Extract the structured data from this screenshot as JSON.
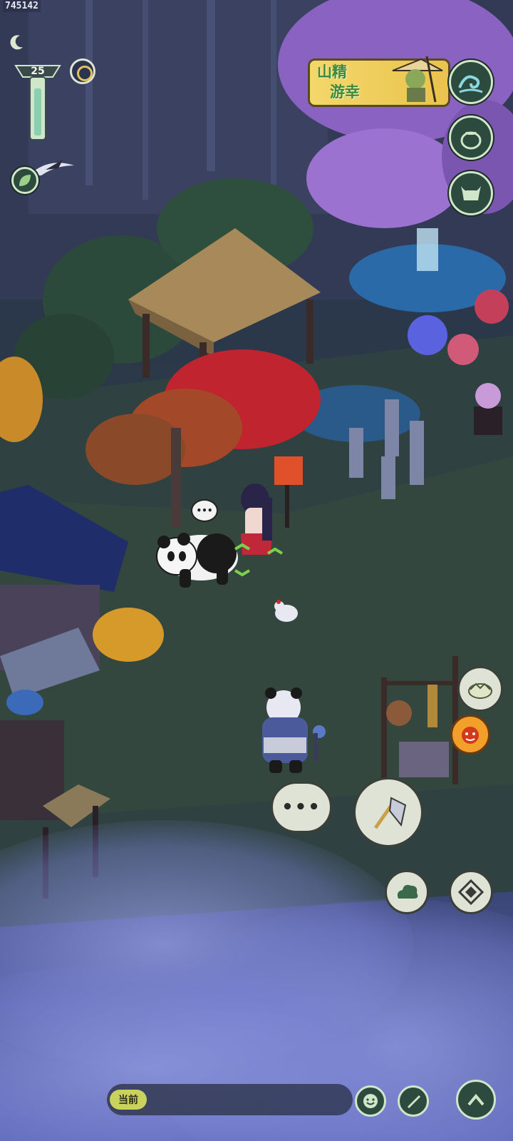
{
  "hud": {
    "player_id": "745142",
    "level": "25"
  },
  "event_banner": {
    "line1": "山精",
    "line2": "游幸"
  },
  "bottom_bar": {
    "chat_channel_label": "当前"
  },
  "icons": {
    "time_moon": "crescent-moon-icon",
    "sun_ring": "ring-sun-icon",
    "leaf": "leaf-icon",
    "wave": "wave-icon",
    "bag": "bag-icon",
    "ox": "ox-icon",
    "speech": "speech-bubble-icon",
    "axe": "axe-icon",
    "cloud": "cloud-swirl-icon",
    "compass": "compass-diamond-icon",
    "smile": "smile-icon",
    "brush": "brush-icon",
    "up": "chevron-up-icon",
    "dumpling": "dumpling-icon",
    "fire_face": "fire-face-icon"
  },
  "colors": {
    "hud_green": "#2d4a3f",
    "hud_border": "#cfe6c8",
    "banner_gold": "#f4d76a",
    "banner_text": "#3a8a3e",
    "chat_tag": "#c9d25c"
  }
}
